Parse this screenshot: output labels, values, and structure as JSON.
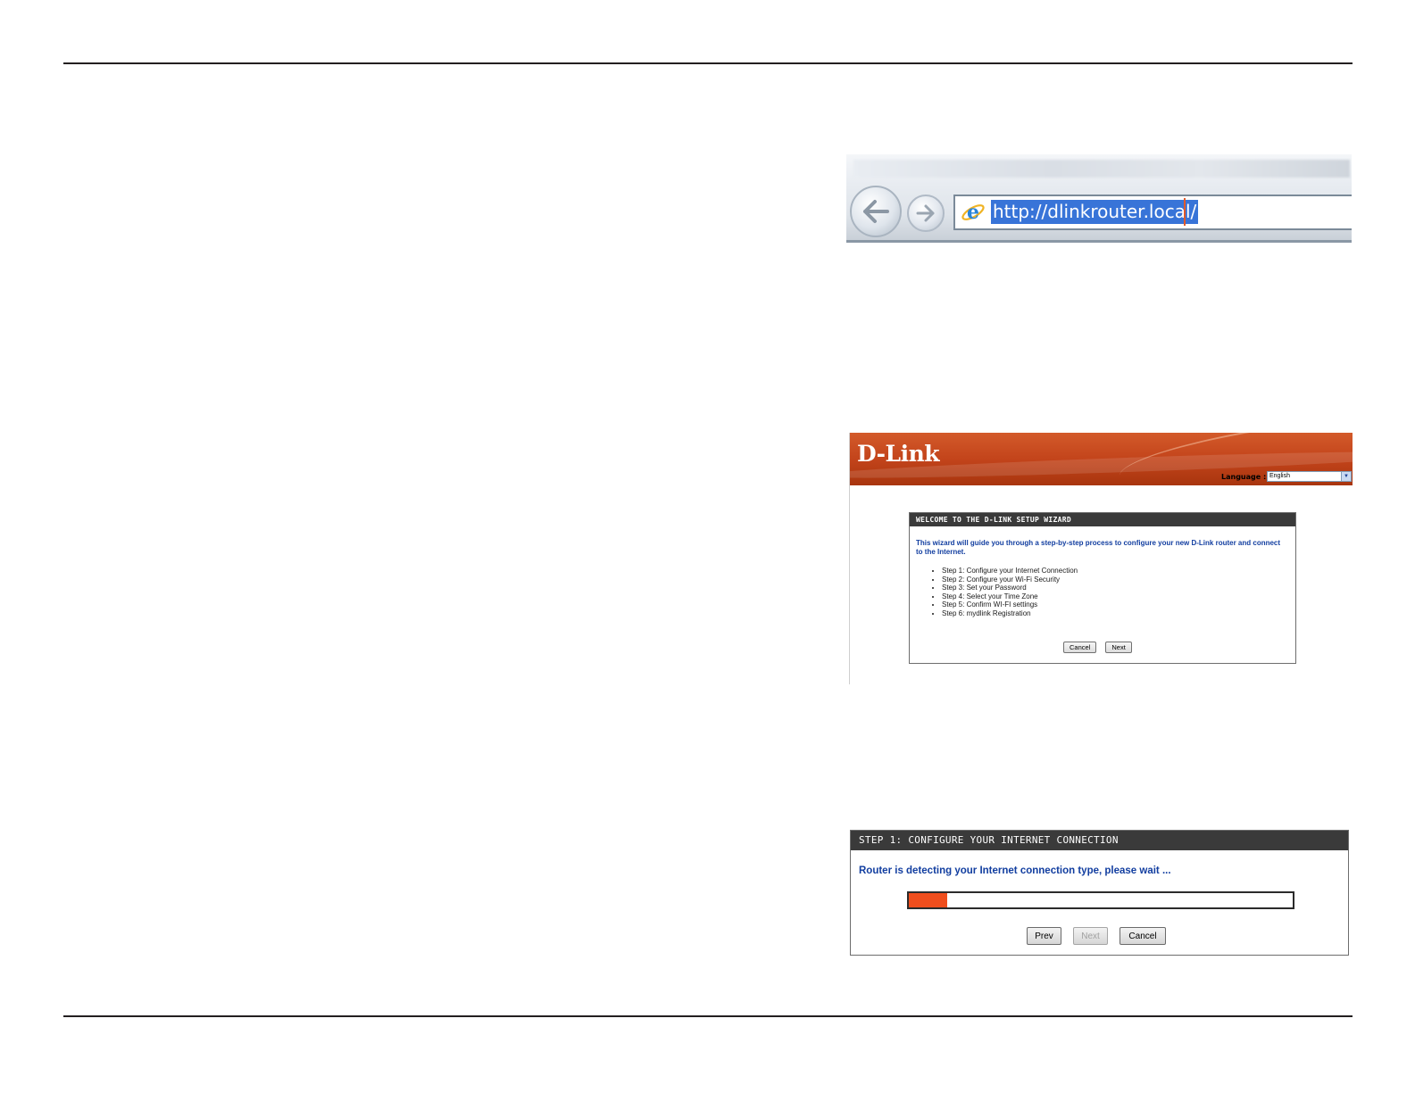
{
  "browser": {
    "url": "http://dlinkrouter.local/",
    "icons": {
      "back": "back-arrow-icon",
      "forward": "forward-arrow-icon",
      "browser": "internet-explorer-icon"
    }
  },
  "wizard": {
    "logo": "D-Link",
    "language_label": "Language :",
    "language_value": "English",
    "header": "WELCOME TO THE D-LINK SETUP WIZARD",
    "intro": "This wizard will guide you through a step-by-step process to configure your new D-Link router and connect to the Internet.",
    "steps": [
      "Step 1: Configure your Internet Connection",
      "Step 2: Configure your Wi-Fi Security",
      "Step 3: Set your Password",
      "Step 4: Select your Time Zone",
      "Step 5: Confirm WI-FI settings",
      "Step 6: mydlink Registration"
    ],
    "cancel_label": "Cancel",
    "next_label": "Next",
    "colors": {
      "banner": "#c3441b",
      "header": "#3a3a3a",
      "intro": "#123ea0"
    }
  },
  "step1": {
    "header": "STEP 1: CONFIGURE YOUR INTERNET CONNECTION",
    "message": "Router is detecting your Internet connection type, please wait ...",
    "progress_percent": 10,
    "prev_label": "Prev",
    "next_label": "Next",
    "cancel_label": "Cancel",
    "colors": {
      "progress_fill": "#f04e1d"
    }
  }
}
